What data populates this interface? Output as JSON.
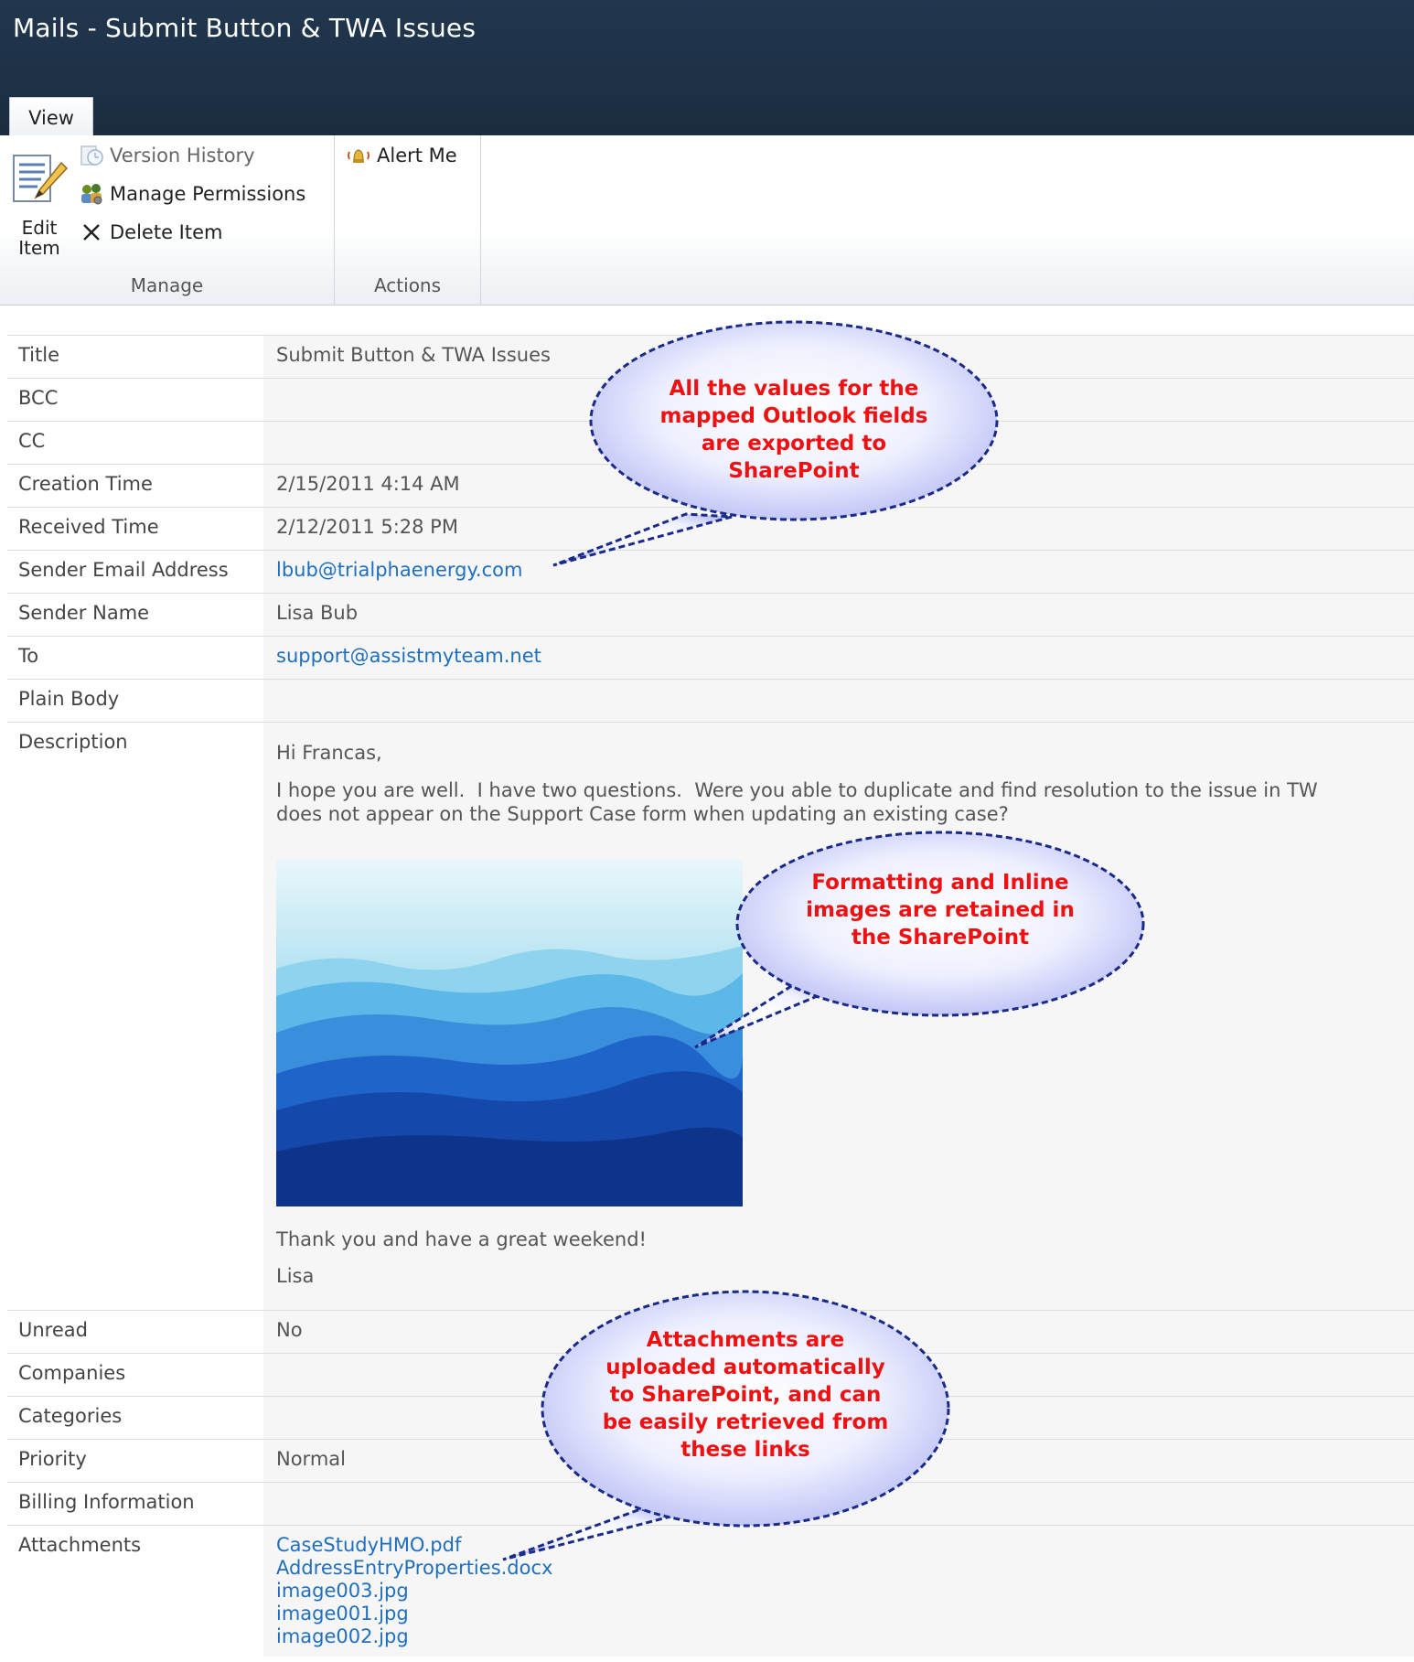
{
  "window": {
    "title": "Mails - Submit Button & TWA Issues"
  },
  "tabs": [
    {
      "label": "View"
    }
  ],
  "ribbon": {
    "edit_item": {
      "line1": "Edit",
      "line2": "Item",
      "icon": "edit-document-icon"
    },
    "version_history": {
      "label": "Version History",
      "icon": "version-history-icon"
    },
    "manage_permissions": {
      "label": "Manage Permissions",
      "icon": "permissions-icon"
    },
    "delete_item": {
      "label": "Delete Item",
      "icon": "delete-x-icon"
    },
    "alert_me": {
      "label": "Alert Me",
      "icon": "alert-bell-icon"
    },
    "group_manage": "Manage",
    "group_actions": "Actions"
  },
  "fields": {
    "title": {
      "label": "Title",
      "value": "Submit Button & TWA Issues"
    },
    "bcc": {
      "label": "BCC",
      "value": ""
    },
    "cc": {
      "label": "CC",
      "value": ""
    },
    "creation_time": {
      "label": "Creation Time",
      "value": "2/15/2011 4:14 AM"
    },
    "received_time": {
      "label": "Received Time",
      "value": "2/12/2011 5:28 PM"
    },
    "sender_email": {
      "label": "Sender Email Address",
      "value": "lbub@trialphaenergy.com"
    },
    "sender_name": {
      "label": "Sender Name",
      "value": "Lisa Bub"
    },
    "to": {
      "label": "To",
      "value": "support@assistmyteam.net"
    },
    "plain_body": {
      "label": "Plain Body",
      "value": ""
    },
    "description": {
      "label": "Description",
      "greeting": "Hi Francas,",
      "body_line1": "I hope you are well.  I have two questions.  Were you able to duplicate and find resolution to the issue in TW",
      "body_line2": "does not appear on the Support Case form when updating an existing case?",
      "closing": "Thank you and have a great weekend!",
      "signature": "Lisa"
    },
    "unread": {
      "label": "Unread",
      "value": "No"
    },
    "companies": {
      "label": "Companies",
      "value": ""
    },
    "categories": {
      "label": "Categories",
      "value": ""
    },
    "priority": {
      "label": "Priority",
      "value": "Normal"
    },
    "billing": {
      "label": "Billing Information",
      "value": ""
    },
    "attachments": {
      "label": "Attachments",
      "files": [
        "CaseStudyHMO.pdf",
        "AddressEntryProperties.docx",
        "image003.jpg",
        "image001.jpg",
        "image002.jpg"
      ]
    }
  },
  "callouts": {
    "c1": {
      "lines": [
        "All the values for the",
        "mapped Outlook fields",
        "are exported to",
        "SharePoint"
      ]
    },
    "c2": {
      "lines": [
        "Formatting and Inline",
        "images are retained in",
        "the SharePoint"
      ]
    },
    "c3": {
      "lines": [
        "Attachments are",
        "uploaded automatically",
        "to SharePoint, and can",
        "be easily retrieved from",
        "these links"
      ]
    }
  },
  "colors": {
    "titlebar": "#1b2c3f",
    "link": "#1f6fbe",
    "callout_text": "#ee1111",
    "callout_border": "#1a2a8a"
  }
}
